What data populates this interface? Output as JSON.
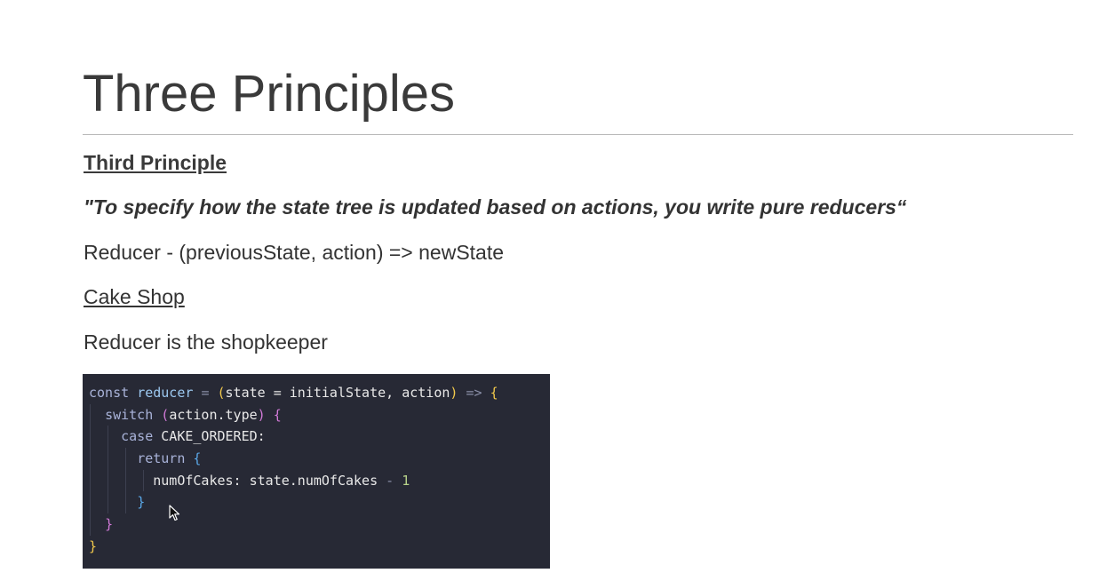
{
  "slide": {
    "title": "Three Principles",
    "subheading": "Third Principle",
    "quote": "\"To specify how the state tree is updated based on actions, you write pure reducers“",
    "reducer_signature": "Reducer - (previousState, action) => newState",
    "cake_shop_link": "Cake Shop",
    "shopkeeper_text": "Reducer is the shopkeeper"
  },
  "code": {
    "line1": {
      "const": "const",
      "name": "reducer",
      "eq": "=",
      "open_paren": "(",
      "params": "state = initialState, action",
      "close_paren": ")",
      "arrow": "=>",
      "open_brace": "{"
    },
    "line2": {
      "switch": "switch",
      "open_paren": "(",
      "expr": "action.type",
      "close_paren": ")",
      "open_brace": "{"
    },
    "line3": {
      "case": "case",
      "label": "CAKE_ORDERED:"
    },
    "line4": {
      "return": "return",
      "open_brace": "{"
    },
    "line5": {
      "expr": "numOfCakes: state.numOfCakes",
      "minus": "-",
      "num": "1"
    },
    "line6": {
      "close_brace": "}"
    },
    "line7": {
      "close_brace": "}"
    },
    "line8": {
      "close_brace": "}"
    }
  },
  "colors": {
    "code_background": "#272935",
    "bracket_level1": "#f2c94c",
    "bracket_level2": "#d27ad8",
    "bracket_level3": "#5aa8e8"
  },
  "icons": {
    "pointer": "mouse-pointer-icon"
  }
}
